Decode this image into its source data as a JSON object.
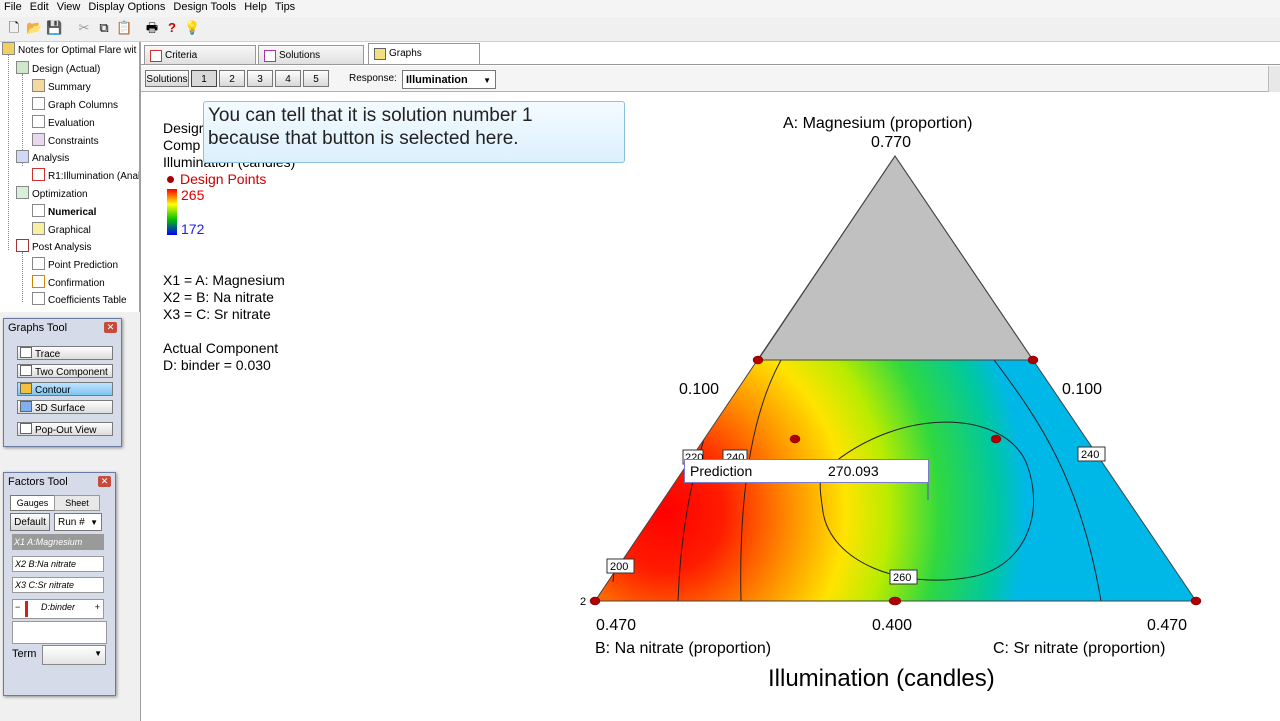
{
  "menu": [
    "File",
    "Edit",
    "View",
    "Display Options",
    "Design Tools",
    "Help",
    "Tips"
  ],
  "toolbar_icons": [
    "new-file-icon",
    "open-folder-icon",
    "save-icon",
    "cut-icon",
    "copy-icon",
    "paste-icon",
    "print-icon",
    "help-icon",
    "tips-lightbulb-icon"
  ],
  "tree": {
    "root": "Notes for Optimal Flare wit",
    "design": "Design (Actual)",
    "summary": "Summary",
    "graph_columns": "Graph Columns",
    "evaluation": "Evaluation",
    "constraints": "Constraints",
    "analysis": "Analysis",
    "r1": "R1:Illumination (Anal",
    "optimization": "Optimization",
    "numerical": "Numerical",
    "graphical": "Graphical",
    "post_analysis": "Post Analysis",
    "point_prediction": "Point Prediction",
    "confirmation": "Confirmation",
    "coefficients_table": "Coefficients Table"
  },
  "graphs_tool": {
    "title": "Graphs Tool",
    "buttons": [
      "Trace",
      "Two Component",
      "Contour",
      "3D Surface"
    ],
    "selected": "Contour",
    "popout": "Pop-Out View"
  },
  "factors_tool": {
    "title": "Factors Tool",
    "tab_gauges": "Gauges",
    "tab_sheet": "Sheet",
    "default_btn": "Default",
    "run_select": "Run #",
    "factors": [
      "X1 A:Magnesium",
      "X2 B:Na nitrate",
      "X3 C:Sr nitrate"
    ],
    "slider_minus": "−",
    "slider_label": "D:binder",
    "slider_plus": "+",
    "term_label": "Term"
  },
  "tabs": [
    "Criteria",
    "Solutions",
    "Graphs"
  ],
  "active_tab": "Graphs",
  "solutions": {
    "label": "Solutions",
    "numbers": [
      "1",
      "2",
      "3",
      "4",
      "5"
    ],
    "selected": "1",
    "response_label": "Response:",
    "response_value": "Illumination"
  },
  "callout": {
    "line1": "You can tell that it is solution number 1",
    "line2": "because that button is selected here."
  },
  "legend": {
    "design_partial": "Desigr",
    "comp_partial": "Comp",
    "response_partial": "Illumination (candles)",
    "design_points": "Design Points",
    "max": "265",
    "min": "172",
    "x1": "X1 = A: Magnesium",
    "x2": "X2 = B: Na nitrate",
    "x3": "X3 = C: Sr nitrate",
    "actual_component": "Actual Component",
    "binder": "D: binder = 0.030"
  },
  "chart_data": {
    "type": "heatmap",
    "subtype": "ternary-contour",
    "title": "Illumination (candles)",
    "axis_top": {
      "label": "A: Magnesium (proportion)",
      "value": "0.770"
    },
    "axis_left_mid": "0.100",
    "axis_right_mid": "0.100",
    "axis_left": {
      "label": "B: Na nitrate (proportion)",
      "value": "0.470"
    },
    "axis_bottom_mid": "0.400",
    "axis_right": {
      "label": "C: Sr nitrate (proportion)",
      "value": "0.470"
    },
    "contour_labels": [
      "220",
      "240",
      "240",
      "200",
      "260"
    ],
    "corner_count_label": "2",
    "color_scale": {
      "min": 172,
      "max": 265,
      "colors": [
        "#0000ff",
        "#00c000",
        "#ffff00",
        "#ff0000"
      ]
    },
    "prediction": {
      "label": "Prediction",
      "value": "270.093"
    }
  }
}
